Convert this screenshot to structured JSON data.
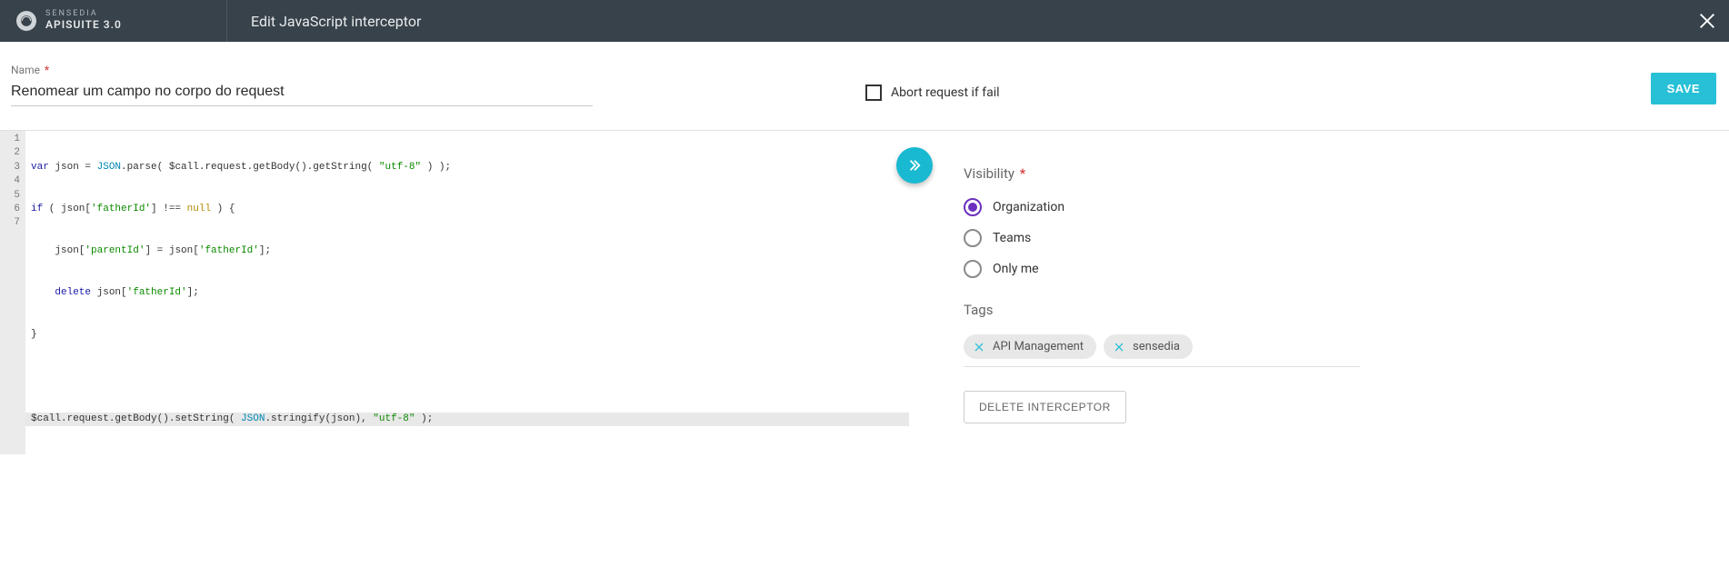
{
  "brand": {
    "top": "SENSEDIA",
    "bottom": "APISUITE 3.0"
  },
  "header": {
    "title": "Edit JavaScript interceptor"
  },
  "form": {
    "name_label": "Name",
    "name_value": "Renomear um campo no corpo do request",
    "abort_label": "Abort request if fail",
    "save_label": "SAVE"
  },
  "editor": {
    "lines": [
      {
        "n": "1",
        "fold": false
      },
      {
        "n": "2",
        "fold": true
      },
      {
        "n": "3",
        "fold": false
      },
      {
        "n": "4",
        "fold": false
      },
      {
        "n": "5",
        "fold": false
      },
      {
        "n": "6",
        "fold": false
      },
      {
        "n": "7",
        "fold": false
      }
    ],
    "code": {
      "l1a": "var",
      "l1b": " json = ",
      "l1c": "JSON",
      "l1d": ".parse( $call.request.getBody().getString( ",
      "l1e": "\"utf-8\"",
      "l1f": " ) );",
      "l2a": "if",
      "l2b": " ( json[",
      "l2c": "'fatherId'",
      "l2d": "] !== ",
      "l2e": "null",
      "l2f": " ) {",
      "l3a": "    json[",
      "l3b": "'parentId'",
      "l3c": "] = json[",
      "l3d": "'fatherId'",
      "l3e": "];",
      "l4a": "    ",
      "l4b": "delete",
      "l4c": " json[",
      "l4d": "'fatherId'",
      "l4e": "];",
      "l5": "}",
      "l6": "",
      "l7a": "$call.request.getBody().setString( ",
      "l7b": "JSON",
      "l7c": ".stringify(json), ",
      "l7d": "\"utf-8\"",
      "l7e": " );"
    }
  },
  "visibility": {
    "title": "Visibility",
    "options": [
      {
        "label": "Organization",
        "checked": true
      },
      {
        "label": "Teams",
        "checked": false
      },
      {
        "label": "Only me",
        "checked": false
      }
    ]
  },
  "tags": {
    "title": "Tags",
    "items": [
      {
        "label": "API Management"
      },
      {
        "label": "sensedia"
      }
    ]
  },
  "delete_label": "DELETE INTERCEPTOR"
}
